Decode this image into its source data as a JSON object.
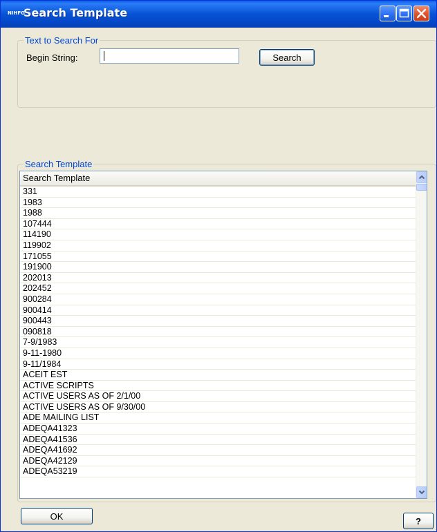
{
  "window": {
    "title": "Search Template",
    "icon_text": "NIHFG",
    "controls": {
      "minimize": "minimize-icon",
      "maximize": "maximize-icon",
      "close": "close-icon"
    }
  },
  "search_group": {
    "legend": "Text to Search For",
    "begin_label": "Begin String:",
    "begin_value": "",
    "search_button": "Search"
  },
  "results_group": {
    "legend": "Search Template",
    "column_header": "Search Template",
    "rows": [
      "331",
      "1983",
      "1988",
      "107444",
      "114190",
      "119902",
      "171055",
      "191900",
      "202013",
      "202452",
      "900284",
      "900414",
      "900443",
      "090818",
      "7-9/1983",
      "9-11-1980",
      "9-11/1984",
      "ACEIT EST",
      "ACTIVE SCRIPTS",
      "ACTIVE USERS AS OF 2/1/00",
      "ACTIVE USERS AS OF 9/30/00",
      "ADE MAILING LIST",
      "ADEQA41323",
      "ADEQA41536",
      "ADEQA41692",
      "ADEQA42129",
      "ADEQA53219"
    ]
  },
  "footer": {
    "ok_button": "OK",
    "help_button": "?"
  },
  "colors": {
    "titlebar": "#0653d6",
    "group_legend": "#0046d5",
    "window_bg": "#ece9d8"
  }
}
